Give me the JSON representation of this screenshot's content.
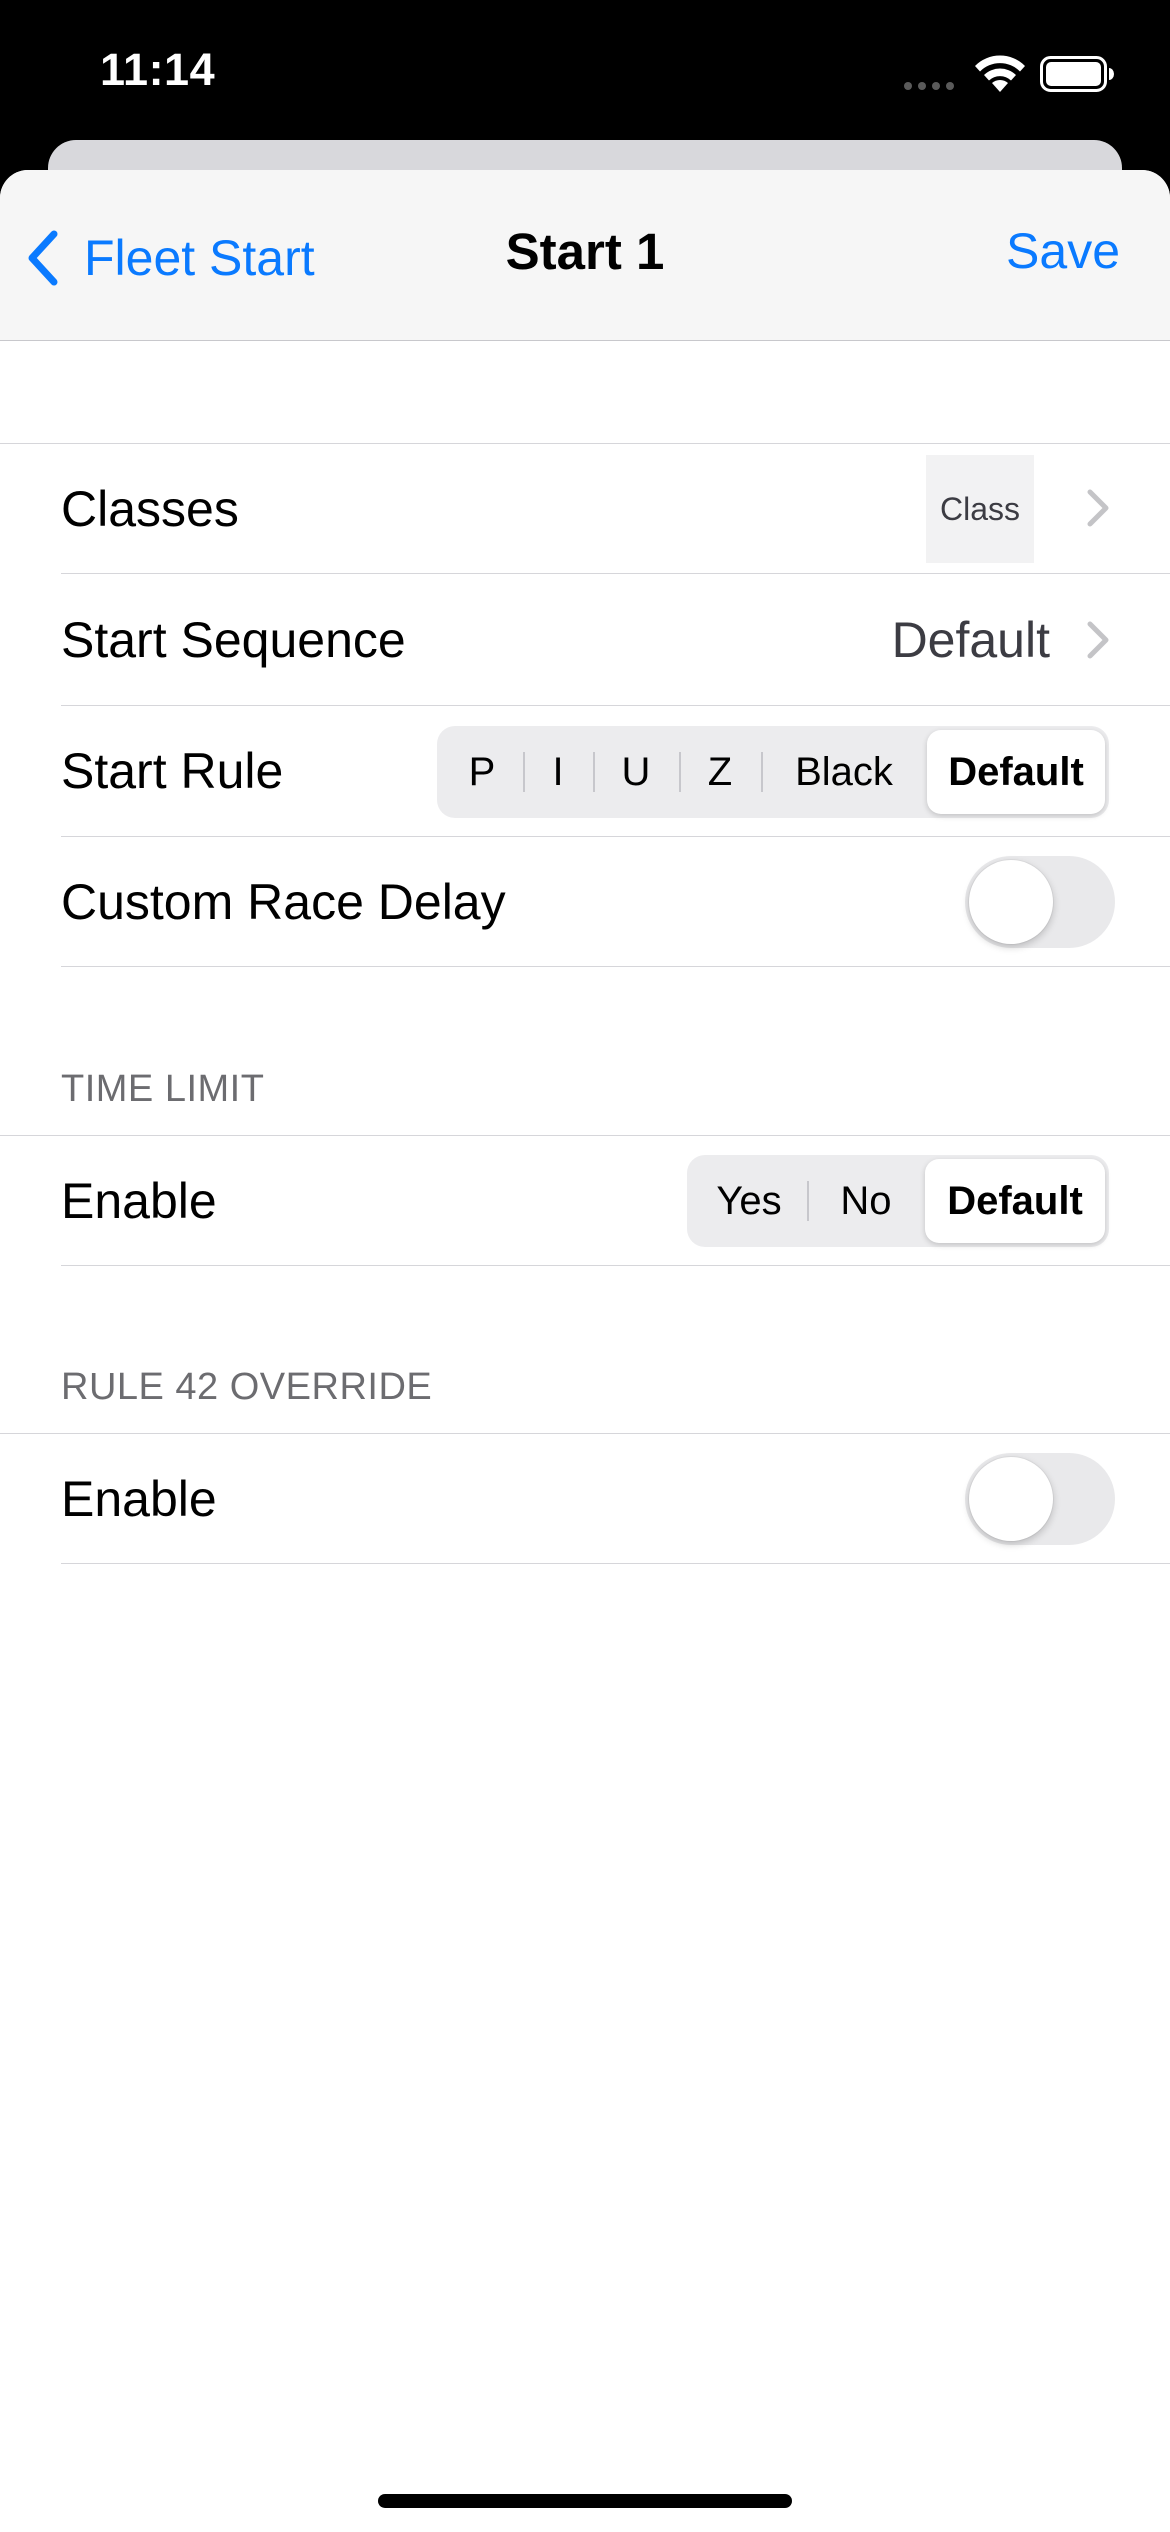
{
  "status_bar": {
    "time": "11:14"
  },
  "nav": {
    "back_label": "Fleet Start",
    "title": "Start 1",
    "save_label": "Save"
  },
  "main": {
    "classes": {
      "label": "Classes",
      "chip_text": "Class"
    },
    "start_sequence": {
      "label": "Start Sequence",
      "value": "Default"
    },
    "start_rule": {
      "label": "Start Rule",
      "options": [
        "P",
        "I",
        "U",
        "Z",
        "Black",
        "Default"
      ],
      "selected": "Default"
    },
    "custom_race_delay": {
      "label": "Custom Race Delay",
      "on": false
    }
  },
  "time_limit": {
    "header": "TIME LIMIT",
    "enable": {
      "label": "Enable",
      "options": [
        "Yes",
        "No",
        "Default"
      ],
      "selected": "Default"
    }
  },
  "rule42": {
    "header": "RULE 42 OVERRIDE",
    "enable": {
      "label": "Enable",
      "on": false
    }
  },
  "colors": {
    "accent": "#0a7aff",
    "toggle_off": "#e9e9eb"
  },
  "icons": [
    "wifi-icon",
    "battery-icon",
    "chevron-left-icon",
    "chevron-right-icon"
  ]
}
